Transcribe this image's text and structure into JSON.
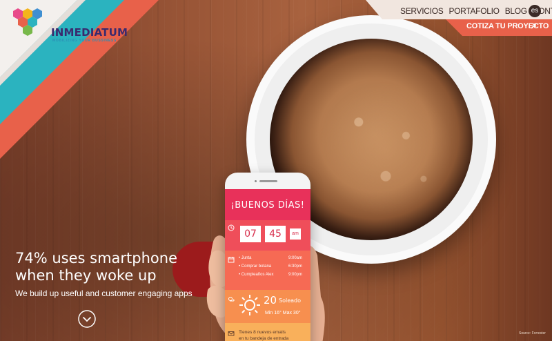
{
  "brand": {
    "name": "INMEDIATUM",
    "tagline": "MOBILIZING YOUR BUSSINESS"
  },
  "nav": {
    "items": [
      "SERVICIOS",
      "PORTAFOLIO",
      "BLOG",
      "CONTACTO"
    ],
    "lang": "es",
    "cta": "COTIZA TU PROYECTO"
  },
  "hero": {
    "headline_line1": "74% uses smartphone",
    "headline_line2": "when they woke up",
    "subline": "We build up useful and customer engaging apps",
    "source": "Source: Forrester"
  },
  "phone": {
    "greeting": "¡BUENOS DÍAS!",
    "hour": "07",
    "minute": "45",
    "ampm": "am",
    "agenda": [
      {
        "title": "• Junta",
        "time": "9:00am"
      },
      {
        "title": "• Comprar botana",
        "time": "6:30pm"
      },
      {
        "title": "• Cumpleaños Alex",
        "time": "9:00pm"
      }
    ],
    "weather": {
      "temp": "20",
      "condition": "Soleado",
      "minmax": "Min 16°  Max 30°"
    },
    "mail_line1": "Tienes 8 nuevos emails",
    "mail_line2": "en tu bandeja de entrada"
  },
  "colors": {
    "stripe_teal": "#2bb3bf",
    "stripe_coral": "#e8614a",
    "cta_bg": "#e8614a",
    "nav_bg": "#f1e6df"
  },
  "icons": [
    "logo-hexagons",
    "arrow-right-icon",
    "chevron-down-icon",
    "clock-icon",
    "calendar-icon",
    "sun-icon",
    "mail-icon"
  ]
}
